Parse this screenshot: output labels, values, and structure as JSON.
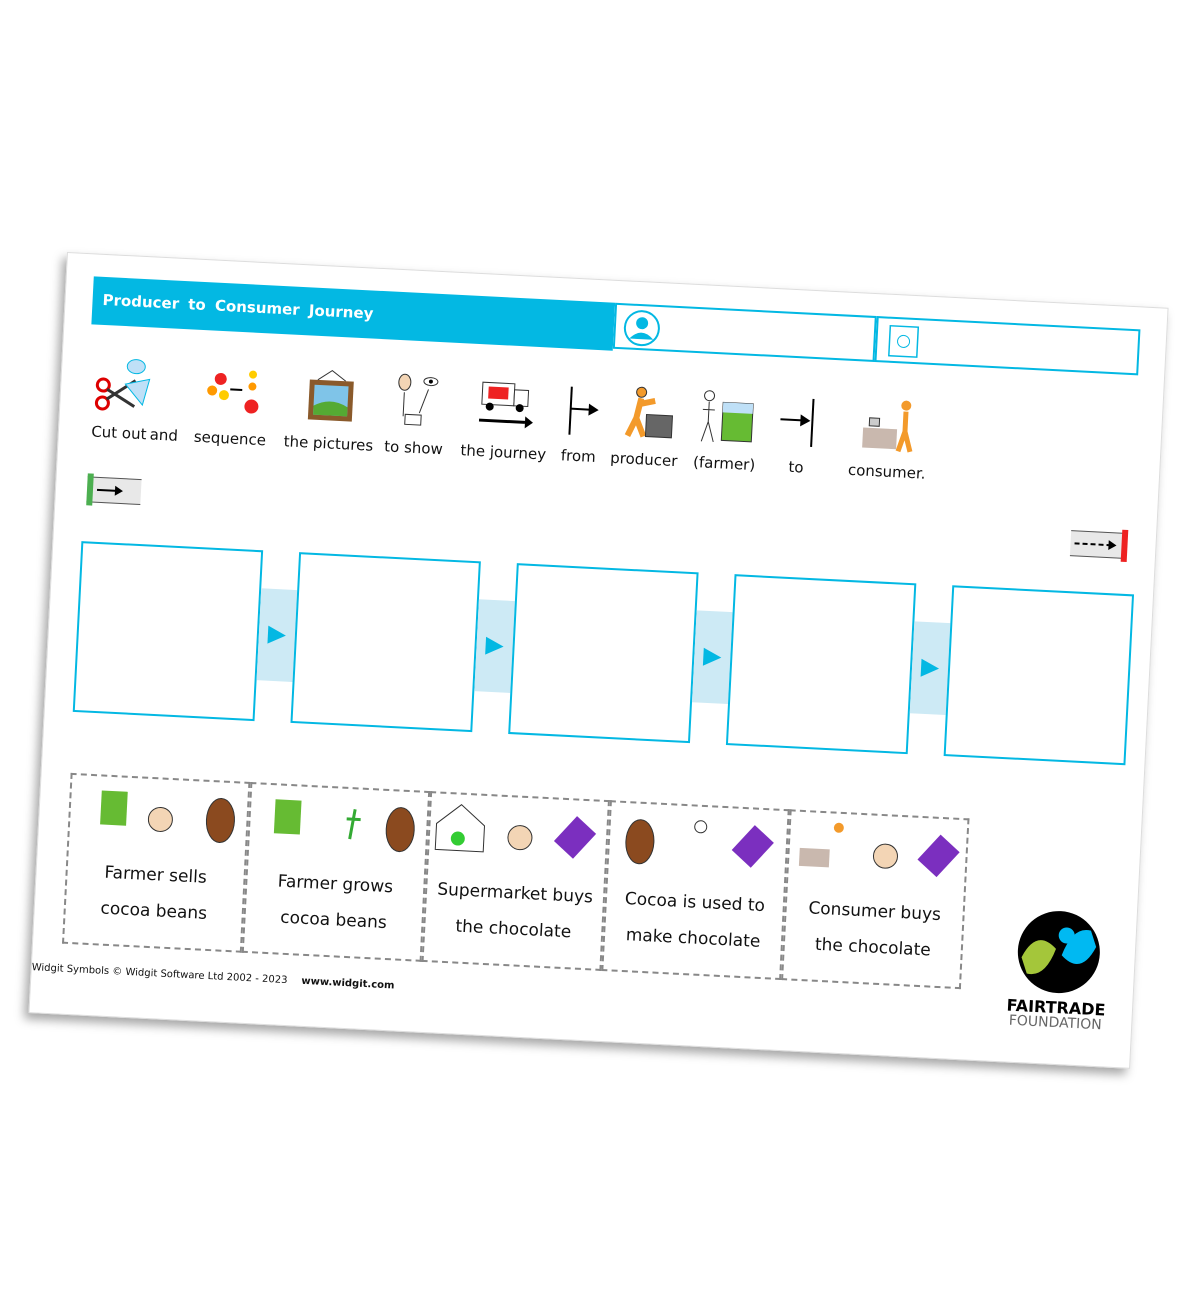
{
  "title": "Producer to Consumer Journey",
  "name_box_icon": "person-icon",
  "date_box_icon": "calendar-sun-icon",
  "colors": {
    "accent": "#03b8e3",
    "connector": "#cdeaf5"
  },
  "instructions": [
    {
      "label": "Cut out",
      "icon": "scissors-icon"
    },
    {
      "label": "and",
      "icon": ""
    },
    {
      "label": "sequence",
      "icon": "sequence-icon"
    },
    {
      "label": "the pictures",
      "icon": "picture-icon"
    },
    {
      "label": "to show",
      "icon": "show-icon"
    },
    {
      "label": "the journey",
      "icon": "truck-journey-icon"
    },
    {
      "label": "from",
      "icon": "from-arrow-icon"
    },
    {
      "label": "producer",
      "icon": "producer-icon"
    },
    {
      "label": "(farmer)",
      "icon": "farmer-icon"
    },
    {
      "label": "to",
      "icon": "to-arrow-icon"
    },
    {
      "label": "consumer.",
      "icon": "consumer-icon"
    }
  ],
  "cards": [
    {
      "line1": "Farmer sells",
      "line2": "cocoa beans"
    },
    {
      "line1": "Farmer grows",
      "line2": "cocoa beans"
    },
    {
      "line1": "Supermarket buys",
      "line2": "the chocolate"
    },
    {
      "line1": "Cocoa is used to",
      "line2": "make chocolate"
    },
    {
      "line1": "Consumer buys",
      "line2": "the chocolate"
    }
  ],
  "footer": {
    "copyright": "Widgit Symbols © Widgit Software Ltd 2002 - 2023",
    "url": "www.widgit.com"
  },
  "logo": {
    "line1": "FAIRTRADE",
    "line2": "FOUNDATION"
  }
}
